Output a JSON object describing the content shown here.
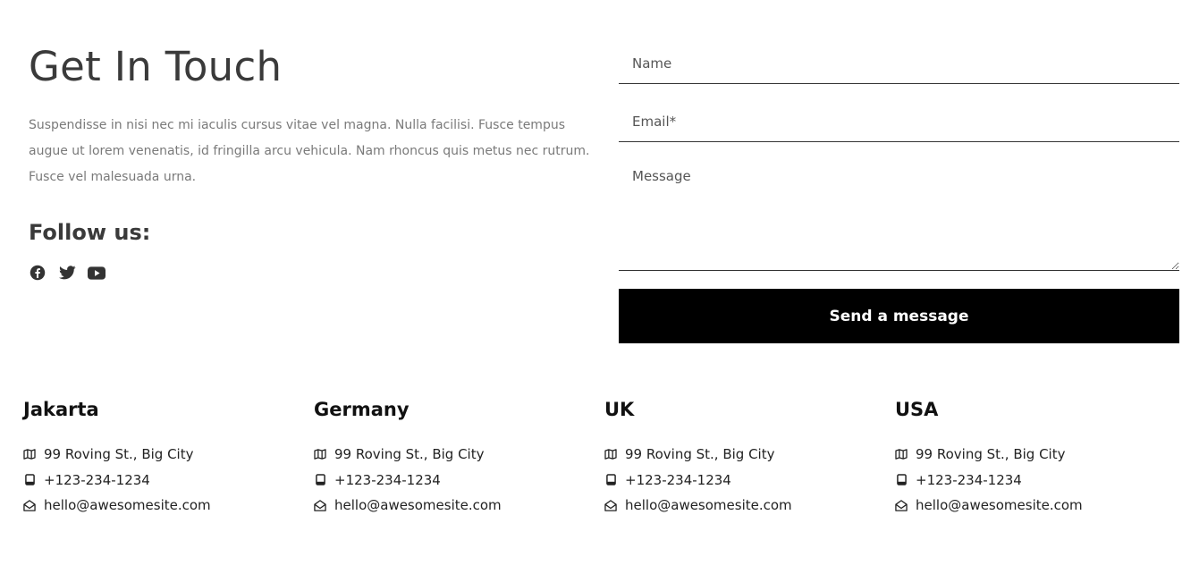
{
  "contact": {
    "title": "Get In Touch",
    "description": "Suspendisse in nisi nec mi iaculis cursus vitae vel magna. Nulla facilisi. Fusce tempus augue ut lorem venenatis, id fringilla arcu vehicula. Nam rhoncus quis metus nec rutrum. Fusce vel malesuada urna.",
    "follow_label": "Follow us:",
    "socials": [
      {
        "icon": "facebook-icon"
      },
      {
        "icon": "twitter-icon"
      },
      {
        "icon": "youtube-icon"
      }
    ]
  },
  "form": {
    "name_placeholder": "Name",
    "email_placeholder": "Email*",
    "message_placeholder": "Message",
    "submit_label": "Send a message"
  },
  "offices": [
    {
      "name": "Jakarta",
      "address": "99 Roving St., Big City",
      "phone": "+123-234-1234",
      "email": "hello@awesomesite.com"
    },
    {
      "name": "Germany",
      "address": "99 Roving St., Big City",
      "phone": "+123-234-1234",
      "email": "hello@awesomesite.com"
    },
    {
      "name": "UK",
      "address": "99 Roving St., Big City",
      "phone": "+123-234-1234",
      "email": "hello@awesomesite.com"
    },
    {
      "name": "USA",
      "address": "99 Roving St., Big City",
      "phone": "+123-234-1234",
      "email": "hello@awesomesite.com"
    }
  ],
  "colors": {
    "button_bg": "#000000",
    "button_text": "#ffffff",
    "heading": "#3a3a3a",
    "body_text": "#7a7a7a"
  }
}
